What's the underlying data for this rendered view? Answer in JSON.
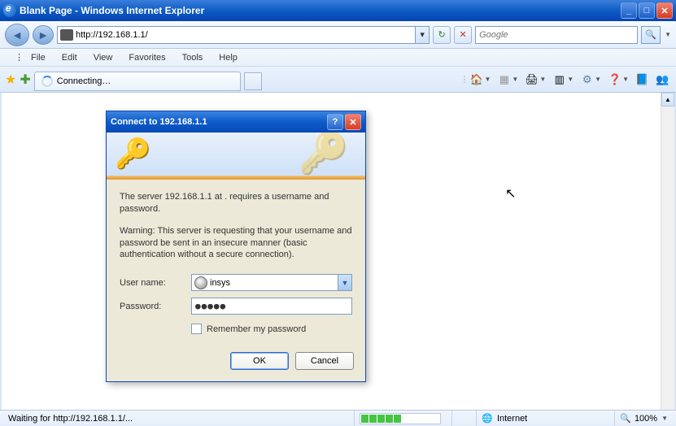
{
  "window": {
    "title": "Blank Page - Windows Internet Explorer"
  },
  "nav": {
    "url": "http://192.168.1.1/",
    "refresh_glyph": "↻",
    "stop_glyph": "✕",
    "search_placeholder": "Google",
    "search_icon": "🔍"
  },
  "menu": {
    "file": "File",
    "edit": "Edit",
    "view": "View",
    "favorites": "Favorites",
    "tools": "Tools",
    "help": "Help"
  },
  "tab": {
    "label": "Connecting…"
  },
  "toolbar_icons": {
    "home": "🏠",
    "feeds": "▦",
    "print": "🖨",
    "page": "▥",
    "tools": "⚙",
    "help": "❓",
    "research": "📘",
    "messenger": "👥"
  },
  "dialog": {
    "title": "Connect to 192.168.1.1",
    "message": "The server 192.168.1.1 at . requires a username and password.",
    "warning": "Warning: This server is requesting that your username and password be sent in an insecure manner (basic authentication without a secure connection).",
    "username_label": "User name:",
    "password_label": "Password:",
    "username_value": "insys",
    "password_mask": "●●●●●",
    "remember": "Remember my password",
    "ok": "OK",
    "cancel": "Cancel"
  },
  "status": {
    "text": "Waiting for http://192.168.1.1/...",
    "zone_icon": "🌐",
    "zone": "Internet",
    "zoom": "100%"
  }
}
